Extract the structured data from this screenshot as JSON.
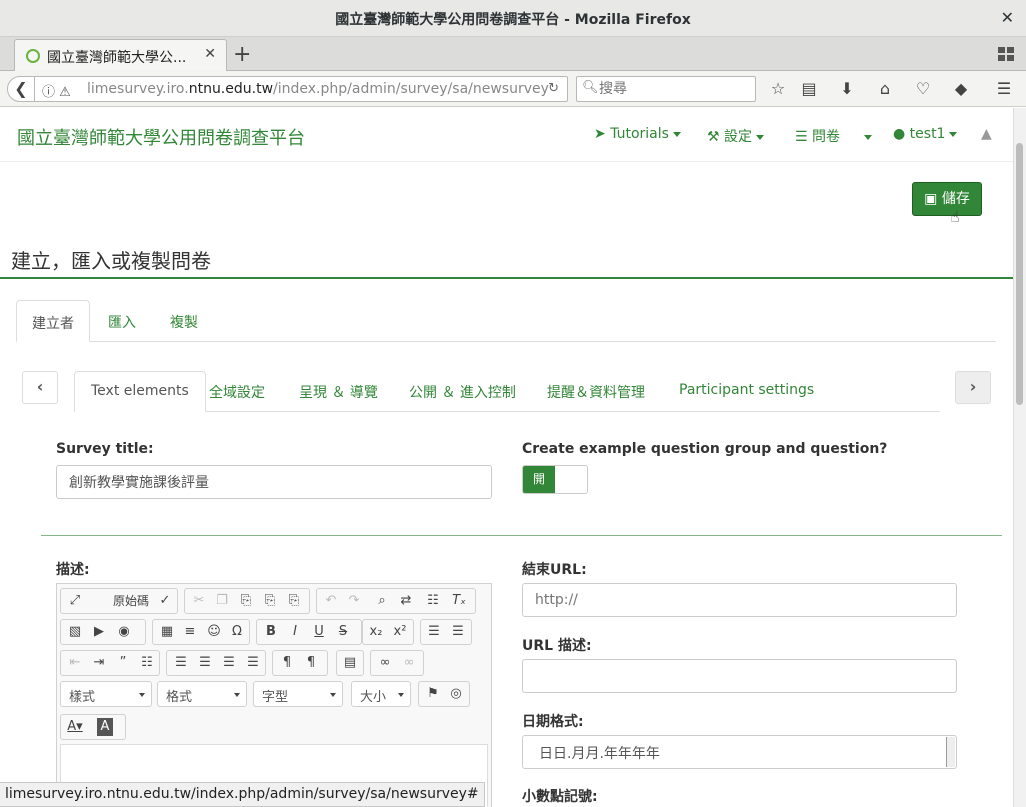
{
  "window": {
    "title": "國立臺灣師範大學公用問卷調查平台 - Mozilla Firefox",
    "close": "✕"
  },
  "tab": {
    "label": "國立臺灣師範大學公...",
    "close": "✕",
    "new_tab": "+"
  },
  "nav": {
    "url_host_prefix": "limesurvey.iro.",
    "url_host_main": "ntnu.edu.tw",
    "url_path": "/index.php/admin/survey/sa/newsurvey",
    "search_placeholder": "搜尋"
  },
  "app": {
    "brand": "國立臺灣師範大學公用問卷調查平台",
    "menu": {
      "tutorials": "Tutorials",
      "settings": "設定",
      "surveys": "問卷",
      "user": "test1"
    }
  },
  "save_button": "儲存",
  "page_title": "建立，匯入或複製問卷",
  "outer_tabs": [
    "建立者",
    "匯入",
    "複製"
  ],
  "inner_tabs": [
    "Text elements",
    "全域設定",
    "呈現 ＆ 導覽",
    "公開 ＆ 進入控制",
    "提醒＆資料管理",
    "Participant settings"
  ],
  "form": {
    "survey_title_label": "Survey title:",
    "survey_title_value": "創新教學實施課後評量",
    "example_label": "Create example question group and question?",
    "toggle_on": "開",
    "description_label": "描述:",
    "end_url_label": "結束URL:",
    "end_url_placeholder": "http://",
    "url_desc_label": "URL 描述:",
    "date_format_label": "日期格式:",
    "date_format_value": "日日.月月.年年年年",
    "decimal_label": "小數點記號:"
  },
  "editor": {
    "source_label": "原始碼",
    "combos": [
      "樣式",
      "格式",
      "字型",
      "大小"
    ]
  },
  "status_url": "limesurvey.iro.ntnu.edu.tw/index.php/admin/survey/sa/newsurvey#",
  "colors": {
    "accent": "#328637"
  }
}
